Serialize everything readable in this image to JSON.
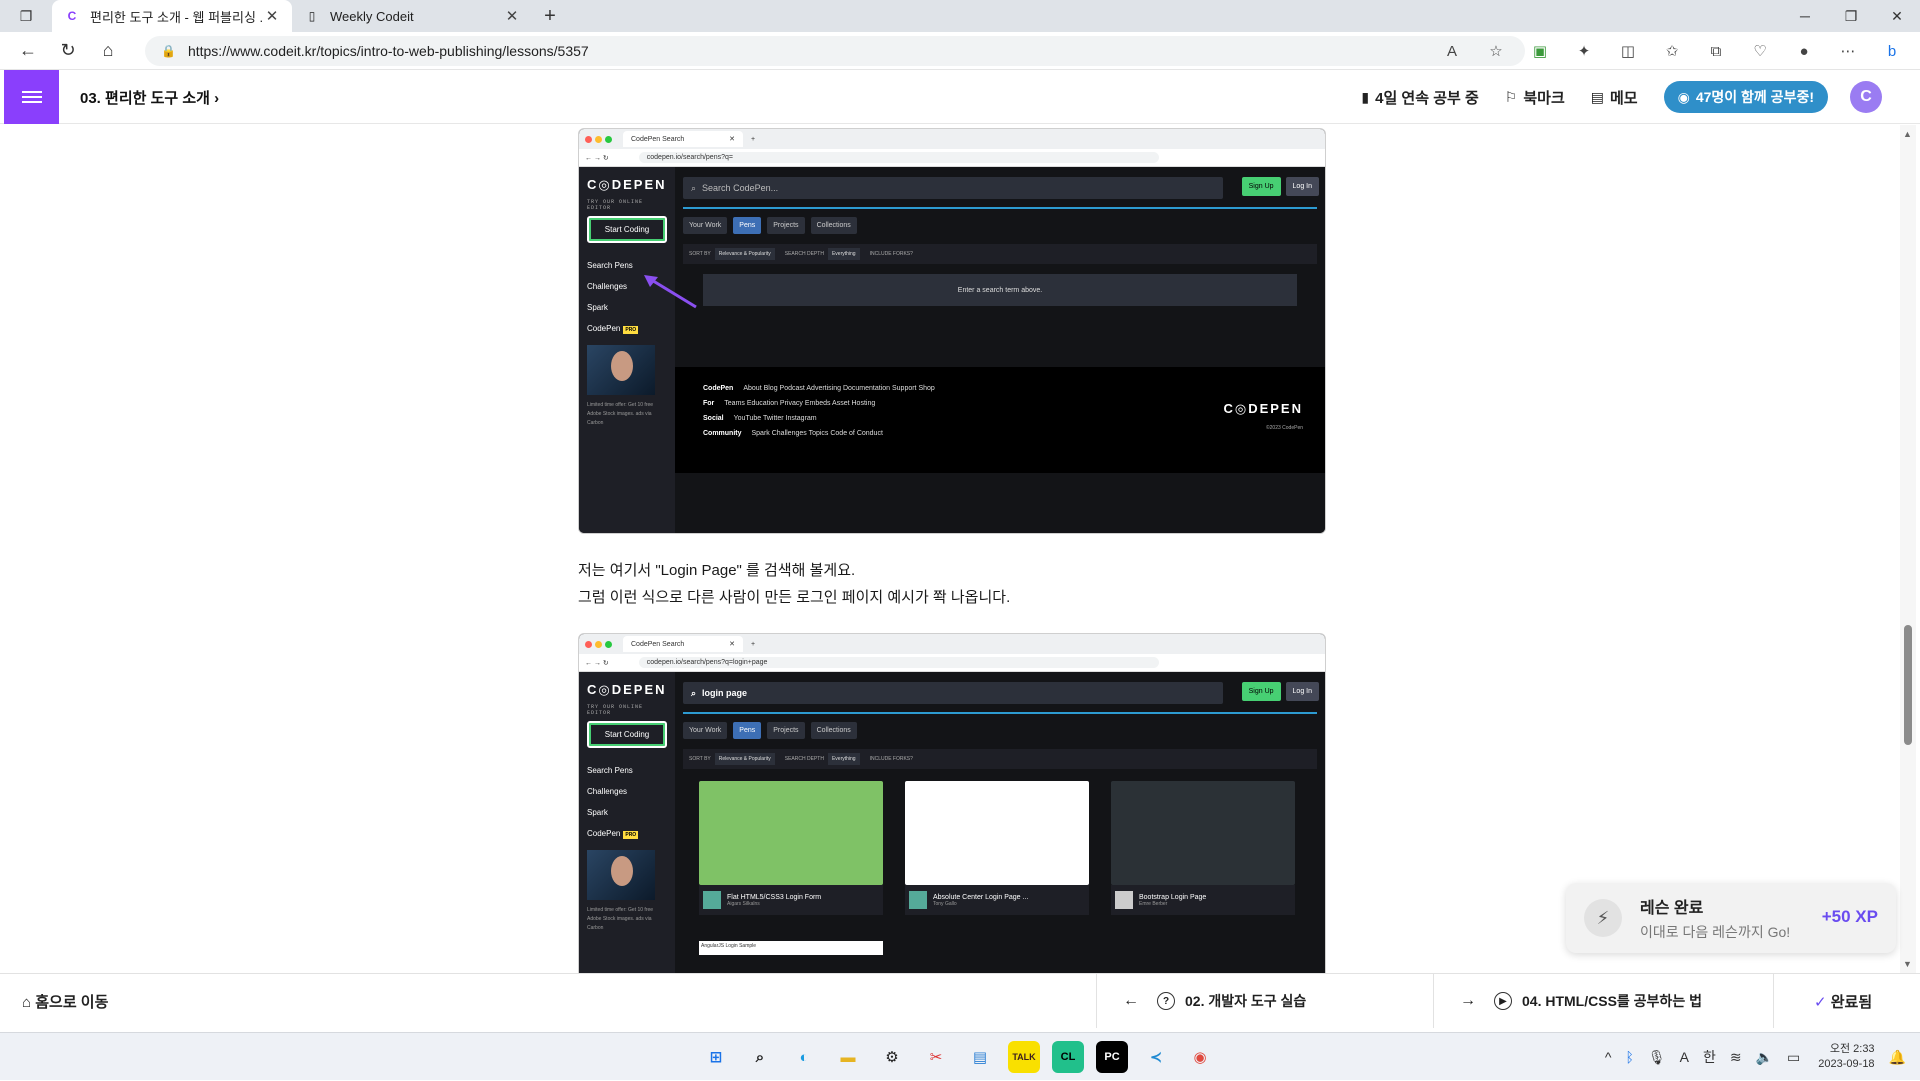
{
  "browser": {
    "tabs": [
      {
        "title": "편리한 도구 소개 - 웹 퍼블리싱 ..."
      },
      {
        "title": "Weekly Codeit"
      }
    ],
    "url": "https://www.codeit.kr/topics/intro-to-web-publishing/lessons/5357"
  },
  "header": {
    "breadcrumb": "03. 편리한 도구 소개",
    "streak": "4일 연속 공부 중",
    "bookmark": "북마크",
    "memo": "메모",
    "studying_now": "47명이 함께 공부중!",
    "avatar_letter": "C"
  },
  "shot1": {
    "tab_title": "CodePen Search",
    "url": "codepen.io/search/pens?q=",
    "logo": "C◎DEPEN",
    "try_label": "TRY OUR ONLINE EDITOR",
    "start_coding": "Start Coding",
    "side_links": [
      "Search Pens",
      "Challenges",
      "Spark"
    ],
    "codepen_pro": "CodePen",
    "pro_badge": "PRO",
    "ad_text": "Limited time offer: Get 10 free Adobe Stock images. ads via Carbon",
    "search_placeholder": "Search CodePen...",
    "signup": "Sign Up",
    "login": "Log In",
    "tabs": [
      "Your Work",
      "Pens",
      "Projects",
      "Collections"
    ],
    "sort_by": "SORT BY",
    "sort_value": "Relevance & Popularity",
    "search_depth": "SEARCH DEPTH",
    "depth_value": "Everything",
    "include_forks": "INCLUDE FORKS?",
    "message": "Enter a search term above.",
    "footer": {
      "codepen": "CodePen",
      "codepen_links": "About  Blog  Podcast  Advertising  Documentation  Support  Shop",
      "for": "For",
      "for_links": "Teams  Education  Privacy  Embeds  Asset Hosting",
      "social": "Social",
      "social_links": "YouTube  Twitter  Instagram",
      "community": "Community",
      "community_links": "Spark  Challenges  Topics  Code of Conduct",
      "copyright": "©2023 CodePen"
    }
  },
  "paragraph": {
    "line1": "저는 여기서 \"Login Page\" 를 검색해 볼게요.",
    "line2": "그럼 이런 식으로 다른 사람이 만든 로그인 페이지 예시가 쫙 나옵니다."
  },
  "shot2": {
    "url": "codepen.io/search/pens?q=login+page",
    "search_value": "login page",
    "cards": [
      {
        "title": "Flat HTML5/CSS3 Login Form",
        "author": "Aigars Silkalns"
      },
      {
        "title": "Absolute Center Login Page ...",
        "author": "Tony Gallo"
      },
      {
        "title": "Bootstrap Login Page",
        "author": "Emre Berber"
      }
    ],
    "next_card": "AngularJS Login Sample"
  },
  "toast": {
    "title": "레슨 완료",
    "subtitle": "이대로 다음 레슨까지 Go!",
    "xp": "+50 XP"
  },
  "footer": {
    "home": "홈으로 이동",
    "prev": "02. 개발자 도구 실습",
    "next": "04. HTML/CSS를 공부하는 법",
    "done": "완료됨"
  },
  "taskbar": {
    "time": "오전 2:33",
    "date": "2023-09-18",
    "ime": "한"
  },
  "colors": {
    "accent": "#8a3ffc",
    "pill": "#2f8fc9",
    "xp": "#6a4cf0"
  }
}
